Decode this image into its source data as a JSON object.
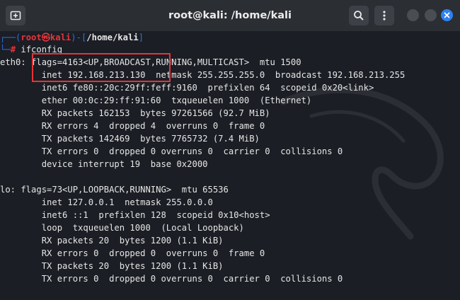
{
  "window": {
    "title": "root@kali: /home/kali"
  },
  "prompt": {
    "top_prefix": "┌──(",
    "user": "root",
    "at_symbol": "㉿",
    "host": "kali",
    "mid": ")-[",
    "path": "/home/kali",
    "close": "]",
    "bottom_prefix": "└─",
    "hash": "#",
    "command": " ifconfig"
  },
  "output": {
    "lines": [
      "eth0: flags=4163<UP,BROADCAST,RUNNING,MULTICAST>  mtu 1500",
      "        inet 192.168.213.130  netmask 255.255.255.0  broadcast 192.168.213.255",
      "        inet6 fe80::20c:29ff:feff:9160  prefixlen 64  scopeid 0x20<link>",
      "        ether 00:0c:29:ff:91:60  txqueuelen 1000  (Ethernet)",
      "        RX packets 162153  bytes 97261566 (92.7 MiB)",
      "        RX errors 4  dropped 4  overruns 0  frame 0",
      "        TX packets 142469  bytes 7765732 (7.4 MiB)",
      "        TX errors 0  dropped 0 overruns 0  carrier 0  collisions 0",
      "        device interrupt 19  base 0x2000",
      "",
      "lo: flags=73<UP,LOOPBACK,RUNNING>  mtu 65536",
      "        inet 127.0.0.1  netmask 255.0.0.0",
      "        inet6 ::1  prefixlen 128  scopeid 0x10<host>",
      "        loop  txqueuelen 1000  (Local Loopback)",
      "        RX packets 20  bytes 1200 (1.1 KiB)",
      "        RX errors 0  dropped 0  overruns 0  frame 0",
      "        TX packets 20  bytes 1200 (1.1 KiB)",
      "        TX errors 0  dropped 0 overruns 0  carrier 0  collisions 0"
    ]
  },
  "colors": {
    "prompt_frame": "#2f6fe0",
    "prompt_user": "#e8333a",
    "highlight_box": "#e8333a",
    "close_button": "#2f81f0"
  },
  "icons": {
    "new_tab": "new-tab-icon",
    "search": "search-icon",
    "menu": "menu-dots-icon",
    "minimize": "minimize-icon",
    "maximize": "maximize-icon",
    "close": "close-icon"
  }
}
